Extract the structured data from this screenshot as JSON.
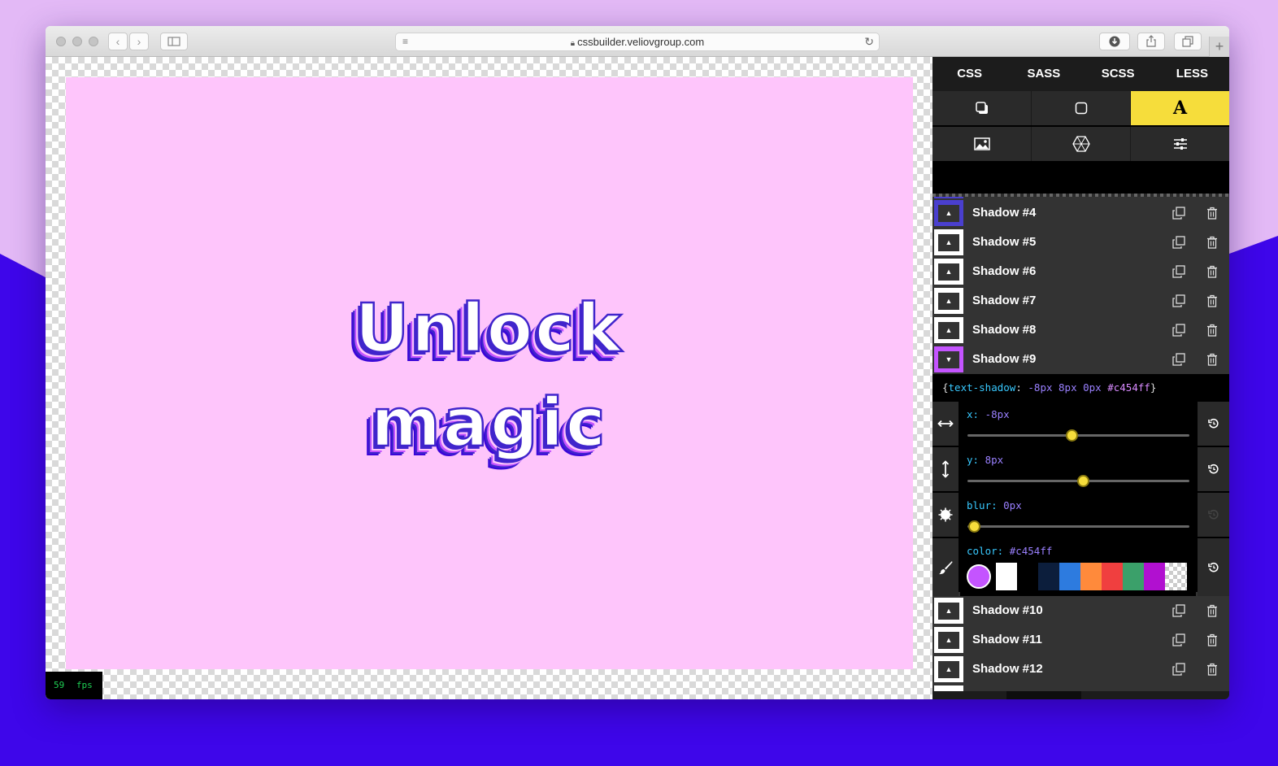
{
  "browser": {
    "url": "cssbuilder.veliovgroup.com"
  },
  "preview": {
    "line1": "Unlock",
    "line2": "magic",
    "fps": "59 fps"
  },
  "panel": {
    "lang_tabs": [
      "CSS",
      "SASS",
      "SCSS",
      "LESS"
    ],
    "tools_row1": [
      "box-shadow-icon",
      "border-radius-icon",
      "text-shadow-icon"
    ],
    "tools_row1_label_active": "A",
    "tools_row2": [
      "image-icon",
      "filter-icon",
      "sliders-icon"
    ],
    "shadows_above": [
      "Shadow #4",
      "Shadow #5",
      "Shadow #6",
      "Shadow #7",
      "Shadow #8"
    ],
    "open_shadow": "Shadow #9",
    "shadows_below": [
      "Shadow #10",
      "Shadow #11",
      "Shadow #12"
    ],
    "code": {
      "open": "{",
      "prop": "text-shadow",
      "colon": ": ",
      "vals": "-8px 8px 0px ",
      "hex": "#c454ff",
      "close": "}"
    },
    "controls": {
      "x_label": "x: ",
      "x_value": "-8px",
      "x_pos": 0.47,
      "y_label": "y: ",
      "y_value": "8px",
      "y_pos": 0.52,
      "blur_label": "blur: ",
      "blur_value": "0px",
      "blur_pos": 0.03,
      "color_label": "color: ",
      "color_value": "#c454ff"
    },
    "swatch_colors": [
      "#c454ff",
      "#ffffff",
      "#000000",
      "#0c1e3c",
      "#2d7bdf",
      "#ff8a3b",
      "#f03f3f",
      "#3ba06a",
      "#b110d0"
    ]
  },
  "colors": {
    "accent_yellow": "#f6dd3b",
    "bg_purple": "#3e06ea",
    "canvas_pink": "#fec5fb",
    "text_outline": "#4025cc"
  }
}
